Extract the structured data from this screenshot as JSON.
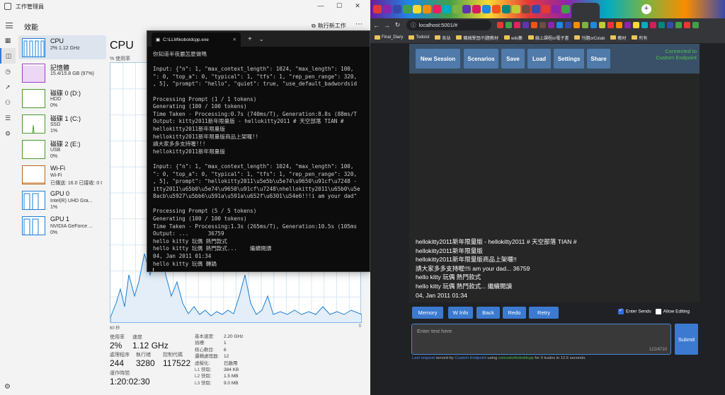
{
  "task_manager": {
    "title": "工作管理員",
    "window_buttons": [
      "—",
      "☐",
      "✕"
    ],
    "page_label": "效能",
    "run_task_label": "執行新工作",
    "more_label": "⋯",
    "devices": [
      {
        "name": "CPU",
        "sub1": "2% 1.12 GHz",
        "sub2": "",
        "color": "#1c7ed6"
      },
      {
        "name": "記憶體",
        "sub1": "15.4/15.8 GB (97%)",
        "sub2": "",
        "color": "#9b3fc8"
      },
      {
        "name": "磁碟 0 (D:)",
        "sub1": "HDD",
        "sub2": "0%",
        "color": "#4a9a2e"
      },
      {
        "name": "磁碟 1 (C:)",
        "sub1": "SSD",
        "sub2": "1%",
        "color": "#4a9a2e"
      },
      {
        "name": "磁碟 2 (E:)",
        "sub1": "USB",
        "sub2": "0%",
        "color": "#4a9a2e"
      },
      {
        "name": "Wi-Fi",
        "sub1": "Wi-Fi",
        "sub2": "已傳送: 16.0 已接收: 0 I",
        "color": "#b86a16"
      },
      {
        "name": "GPU 0",
        "sub1": "Intel(R) UHD Gra...",
        "sub2": "1%",
        "color": "#1c7ed6"
      },
      {
        "name": "GPU 1",
        "sub1": "NVIDIA GeForce ...",
        "sub2": "0%",
        "color": "#1c7ed6"
      }
    ],
    "cpu_heading": "CPU",
    "pct_label": "% 使用率",
    "graph_left": "60 秒",
    "graph_right": "0",
    "stats": {
      "usage_label": "使用率",
      "usage_value": "2%",
      "speed_label": "速度",
      "speed_value": "1.12 GHz",
      "processes_label": "處理程序",
      "processes_value": "244",
      "threads_label": "執行緒",
      "threads_value": "3280",
      "handles_label": "控制代碼",
      "handles_value": "117522",
      "uptime_label": "運作時間",
      "uptime_value": "1:20:02:30"
    },
    "specs": [
      {
        "k": "基本速度:",
        "v": "2.20 GHz"
      },
      {
        "k": "插槽:",
        "v": "1"
      },
      {
        "k": "核心數目:",
        "v": "6"
      },
      {
        "k": "邏輯處理器:",
        "v": "12"
      },
      {
        "k": "虛擬化:",
        "v": "已啟用"
      },
      {
        "k": "L1 快取:",
        "v": "384 KB"
      },
      {
        "k": "L2 快取:",
        "v": "1.5 MB"
      },
      {
        "k": "L3 快取:",
        "v": "9.0 MB"
      }
    ]
  },
  "console": {
    "tab_title": "C:\\LLM\\koboldcpp.exe",
    "lines": [
      "你知道半夜嚴怎麼做嗎",
      "",
      "Input: {\"n\": 1, \"max_context_length\": 1024, \"max_length\": 100,",
      "\": 0, \"top_a\": 0, \"typical\": 1, \"tfs\": 1, \"rep_pen_range\": 320,",
      ", 5], \"prompt\": \"hello\", \"quiet\": true, \"use_default_badwordsid",
      "",
      "Processing Prompt (1 / 1 tokens)",
      "Generating (100 / 100 tokens)",
      "Time Taken - Processing:0.7s (740ms/T), Generation:8.8s (88ms/T",
      "Output: kitty2011新年限量版 - hellokitty2011 # 天空部落 TIAN #",
      "hellokitty2011新年限量版",
      "hellokitty2011新年限量版商品上架囉!!",
      "請大家多多支持喔!!!",
      "hellokitty2011新年限量版",
      "",
      "Input: {\"n\": 1, \"max_context_length\": 1024, \"max_length\": 100,",
      "\": 0, \"top_a\": 0, \"typical\": 1, \"tfs\": 1, \"rep_pen_range\": 320,",
      ", 5], \"prompt\": \"hellokitty2011\\u5e5b\\u5e74\\u9650\\u91cf\\u7248 -",
      "itty2011\\u65b0\\u5e74\\u9650\\u91cf\\u7248\\nhellokitty2011\\u65b0\\u5e",
      "8acb\\u5927\\u5bb6\\u591a\\u591a\\u652f\\u6301\\u54e6!!!i am your dad\"",
      "",
      "Processing Prompt (5 / 5 tokens)",
      "Generating (100 / 100 tokens)",
      "Time Taken - Processing:1.3s (265ms/T), Generation:10.5s (105ms",
      "Output: ...      36759",
      "hello kitty 玩偶 熱門款式",
      "hello kitty 玩偶 熱門款式...    繼續閱讀",
      "04, Jan 2011 01:34",
      "hello kitty 玩偶 轉鍋"
    ]
  },
  "browser": {
    "url": "localhost:5001/#",
    "bookmarks": [
      "Final_Diary",
      "Todoist",
      "各站",
      "職稱學習/刊題教材",
      "wiki集",
      "線上課程or電子書",
      "刊題orColab",
      "教材",
      "所有"
    ],
    "kobold": {
      "top_buttons": [
        "New Session",
        "Scenarios",
        "Save",
        "Load",
        "Settings",
        "Share"
      ],
      "connected_text": "Connected to Custom Endpoint",
      "story_lines": [
        "hellokitty2011新年限量版 - hellokitty2011 # 天空部落 TIAN #",
        "hellokitty2011新年限量版",
        "hellokitty2011新年限量版商品上架囉!!",
        "請大家多多支持喔!!!i am your dad... 36759",
        "hello kitty 玩偶 熱門款式",
        "hello kitty 玩偶 熱門款式... 繼續閱讀",
        "04, Jan 2011 01:34"
      ],
      "action_buttons": [
        "Memory",
        "W Info",
        "Back",
        "Redo",
        "Retry"
      ],
      "enter_sends_label": "Enter Sends",
      "allow_editing_label": "Allow Editing",
      "enter_sends_checked": true,
      "allow_editing_checked": false,
      "input_placeholder": "Enter text here",
      "char_count": "122/4710",
      "submit_label": "Submit",
      "footer": {
        "last_request": "Last request",
        "served_by": " served by ",
        "endpoint": "Custom Endpoint",
        "using": " using ",
        "model": "concedo/koboldcpp",
        "tail": " for 0 kudos in 12.6 seconds."
      }
    }
  }
}
